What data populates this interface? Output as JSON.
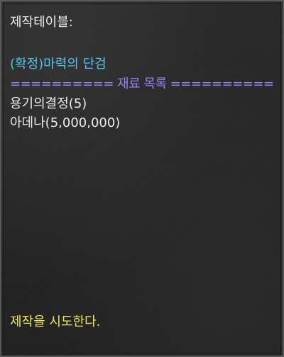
{
  "dialog": {
    "title": "제작테이블:",
    "item_name": "(확정)마력의 단검",
    "separator": "========== 재료 목록 ==========",
    "materials": [
      "용기의결정(5)",
      "아데나(5,000,000)"
    ],
    "craft_action": "제작을 시도한다."
  },
  "colors": {
    "text": "#ececec",
    "item_name": "#4fc3e8",
    "separator": "#9a7ff0",
    "action_link": "#f0e85a",
    "background": "#262626"
  }
}
